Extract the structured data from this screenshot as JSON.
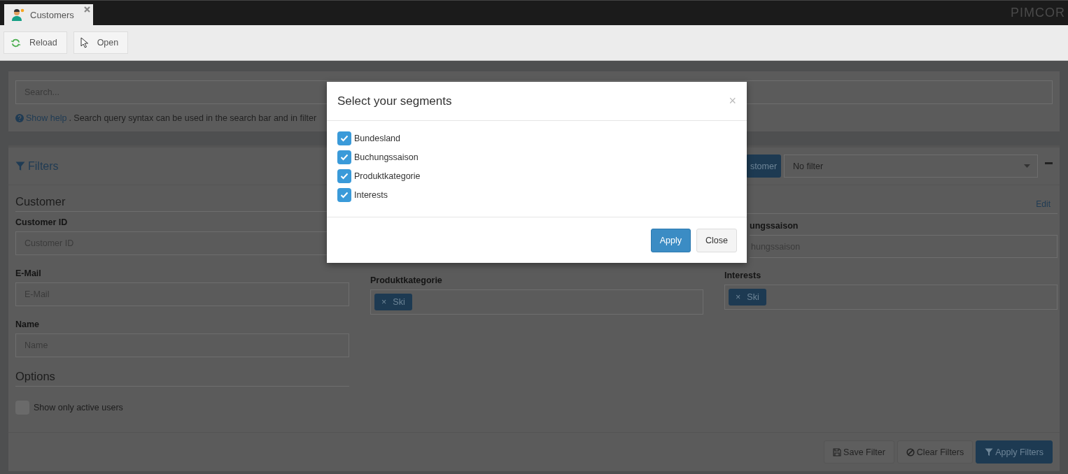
{
  "tabs": [
    {
      "label": "Customers",
      "selected": true
    }
  ],
  "logo": "PIMCOR",
  "toolbar": [
    {
      "label": "Reload",
      "kind": "reload"
    },
    {
      "label": "Open",
      "kind": "pointer"
    }
  ],
  "search": {
    "placeholder": "Search...",
    "help_link": "Show help",
    "help_text": ". Search query syntax can be used in the search bar and in filter"
  },
  "filters": {
    "title": "Filters",
    "segment_button": "stomer",
    "select_value": "No filter",
    "customer": {
      "heading": "Customer",
      "fields": [
        {
          "label": "Customer ID",
          "placeholder": "Customer ID"
        },
        {
          "label": "E-Mail",
          "placeholder": "E-Mail"
        },
        {
          "label": "Name",
          "placeholder": "Name"
        }
      ]
    },
    "options": {
      "heading": "Options",
      "items": [
        {
          "label": "Show only active users",
          "checked": false
        }
      ]
    },
    "segments": {
      "edit_link": "Edit",
      "season_label": "ungssaison",
      "season_placeholder": "hungssaison",
      "tag_fields": [
        {
          "label": "Produktkategorie",
          "tags": [
            {
              "label": "Ski",
              "remove": "×"
            }
          ]
        },
        {
          "label": "Interests",
          "tags": [
            {
              "label": "Ski",
              "remove": "×"
            }
          ]
        }
      ]
    },
    "buttons": [
      {
        "label": "Save Filter",
        "kind": "save"
      },
      {
        "label": "Clear Filters",
        "kind": "clear"
      },
      {
        "label": "Apply Filters",
        "kind": "apply"
      }
    ]
  },
  "modal": {
    "title": "Select your segments",
    "close": "×",
    "options": [
      {
        "label": "Bundesland",
        "checked": true
      },
      {
        "label": "Buchungssaison",
        "checked": true
      },
      {
        "label": "Produktkategorie",
        "checked": true
      },
      {
        "label": "Interests",
        "checked": true
      }
    ],
    "buttons": [
      {
        "label": "Apply",
        "kind": "primary"
      },
      {
        "label": "Close",
        "kind": "default"
      }
    ]
  }
}
